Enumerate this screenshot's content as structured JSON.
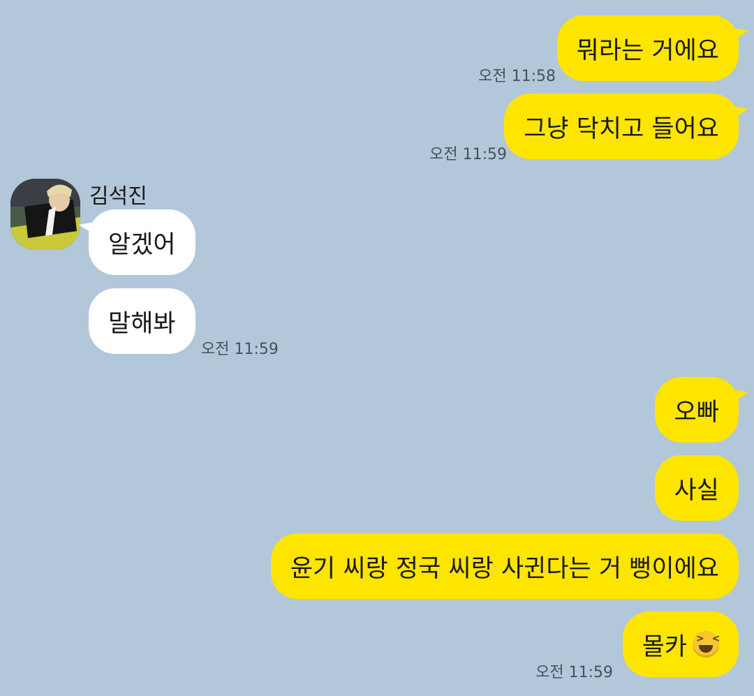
{
  "chat": {
    "messages": [
      {
        "text": "뭐라는 거에요",
        "time": "오전 11:58"
      },
      {
        "text": "그냥 닥치고 들어요",
        "time": "오전 11:59"
      },
      {
        "text": "알겠어"
      },
      {
        "text": "말해봐",
        "time": "오전 11:59"
      },
      {
        "text": "오빠"
      },
      {
        "text": "사실"
      },
      {
        "text": "윤기 씨랑 정국 씨랑 사귄다는 거 뻥이에요"
      },
      {
        "text": "몰카",
        "emoji": "laughing-squinting-face-icon",
        "time": "오전 11:59"
      }
    ],
    "sender": {
      "name": "김석진"
    }
  },
  "colors": {
    "background": "#b2c7da",
    "outgoing_bubble": "#fee500",
    "incoming_bubble": "#ffffff"
  }
}
